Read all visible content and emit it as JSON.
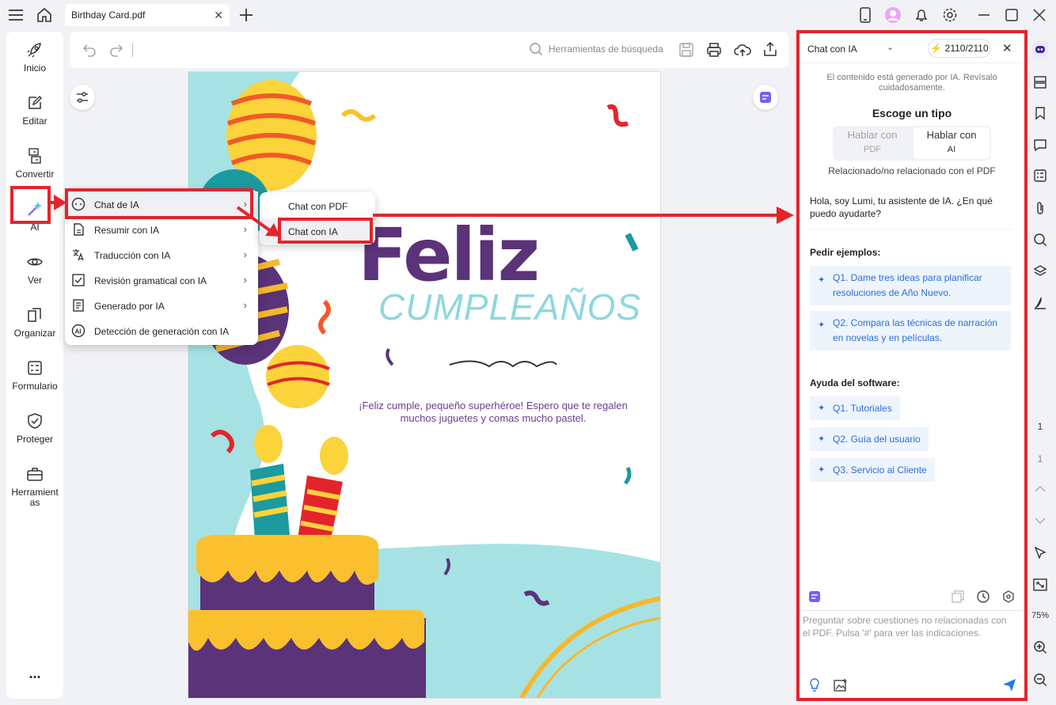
{
  "tab": {
    "title": "Birthday Card.pdf"
  },
  "sidebar": {
    "items": [
      {
        "label": "Inicio",
        "icon": "rocket-icon"
      },
      {
        "label": "Editar",
        "icon": "edit-icon"
      },
      {
        "label": "Convertir",
        "icon": "convert-icon"
      },
      {
        "label": "AI",
        "icon": "ai-sparkle-icon"
      },
      {
        "label": "Ver",
        "icon": "eye-icon"
      },
      {
        "label": "Organizar",
        "icon": "organize-icon"
      },
      {
        "label": "Formulario",
        "icon": "form-icon"
      },
      {
        "label": "Proteger",
        "icon": "shield-icon"
      },
      {
        "label": "Herramientas",
        "icon": "toolbox-icon"
      }
    ],
    "more": "..."
  },
  "toolbar": {
    "search_placeholder": "Herramientas de búsqueda"
  },
  "menu": {
    "items": [
      {
        "label": "Chat de IA",
        "icon": "chat-ai-icon",
        "has_submenu": true
      },
      {
        "label": "Resumir con IA",
        "icon": "summarize-icon",
        "has_submenu": true
      },
      {
        "label": "Traducción con IA",
        "icon": "translate-icon",
        "has_submenu": true
      },
      {
        "label": "Revisión gramatical con IA",
        "icon": "grammar-check-icon",
        "has_submenu": true
      },
      {
        "label": "Generado por IA",
        "icon": "generated-doc-icon",
        "has_submenu": true
      },
      {
        "label": "Detección de generación con IA",
        "icon": "ai-detect-icon",
        "has_submenu": false
      }
    ],
    "submenu": [
      {
        "label": "Chat con PDF"
      },
      {
        "label": "Chat con IA"
      }
    ]
  },
  "document": {
    "title_big": "Feliz",
    "title_sub": "CUMPLEAÑOS",
    "message": "¡Feliz cumple, pequeño superhéroe! Espero que te regalen muchos juguetes y comas mucho pastel."
  },
  "ai_panel": {
    "mode": "Chat con IA",
    "credits": "2110/2110",
    "notice": "El contenido está generado por IA. Revísalo cuidadosamente.",
    "choose_type": "Escoge un tipo",
    "toggle": [
      {
        "line1": "Hablar con",
        "line2": "PDF",
        "selected": false
      },
      {
        "line1": "Hablar con",
        "line2": "AI",
        "selected": true
      }
    ],
    "related": "Relacionado/no relacionado con el PDF",
    "greeting": "Hola, soy Lumi, tu asistente de IA. ¿En qué puedo ayudarte?",
    "examples_heading": "Pedir ejemplos:",
    "examples": [
      "Q1. Dame tres ideas para planificar resoluciones de Año Nuevo.",
      "Q2. Compara las técnicas de narración en novelas y en películas."
    ],
    "help_heading": "Ayuda del software:",
    "help": [
      "Q1. Tutoriales",
      "Q2. Guía del usuario",
      "Q3. Servicio al Cliente"
    ],
    "input_placeholder": "Preguntar sobre cuestiones no relacionadas con el PDF. Pulsa '#' para ver las indicaciones."
  },
  "right_bar": {
    "page_current": "1",
    "page_total": "1",
    "zoom": "75%"
  },
  "colors": {
    "highlight": "#e4242c",
    "link": "#2b6fd6",
    "feliz": "#5a3378",
    "cumple": "#8fd8dc"
  }
}
